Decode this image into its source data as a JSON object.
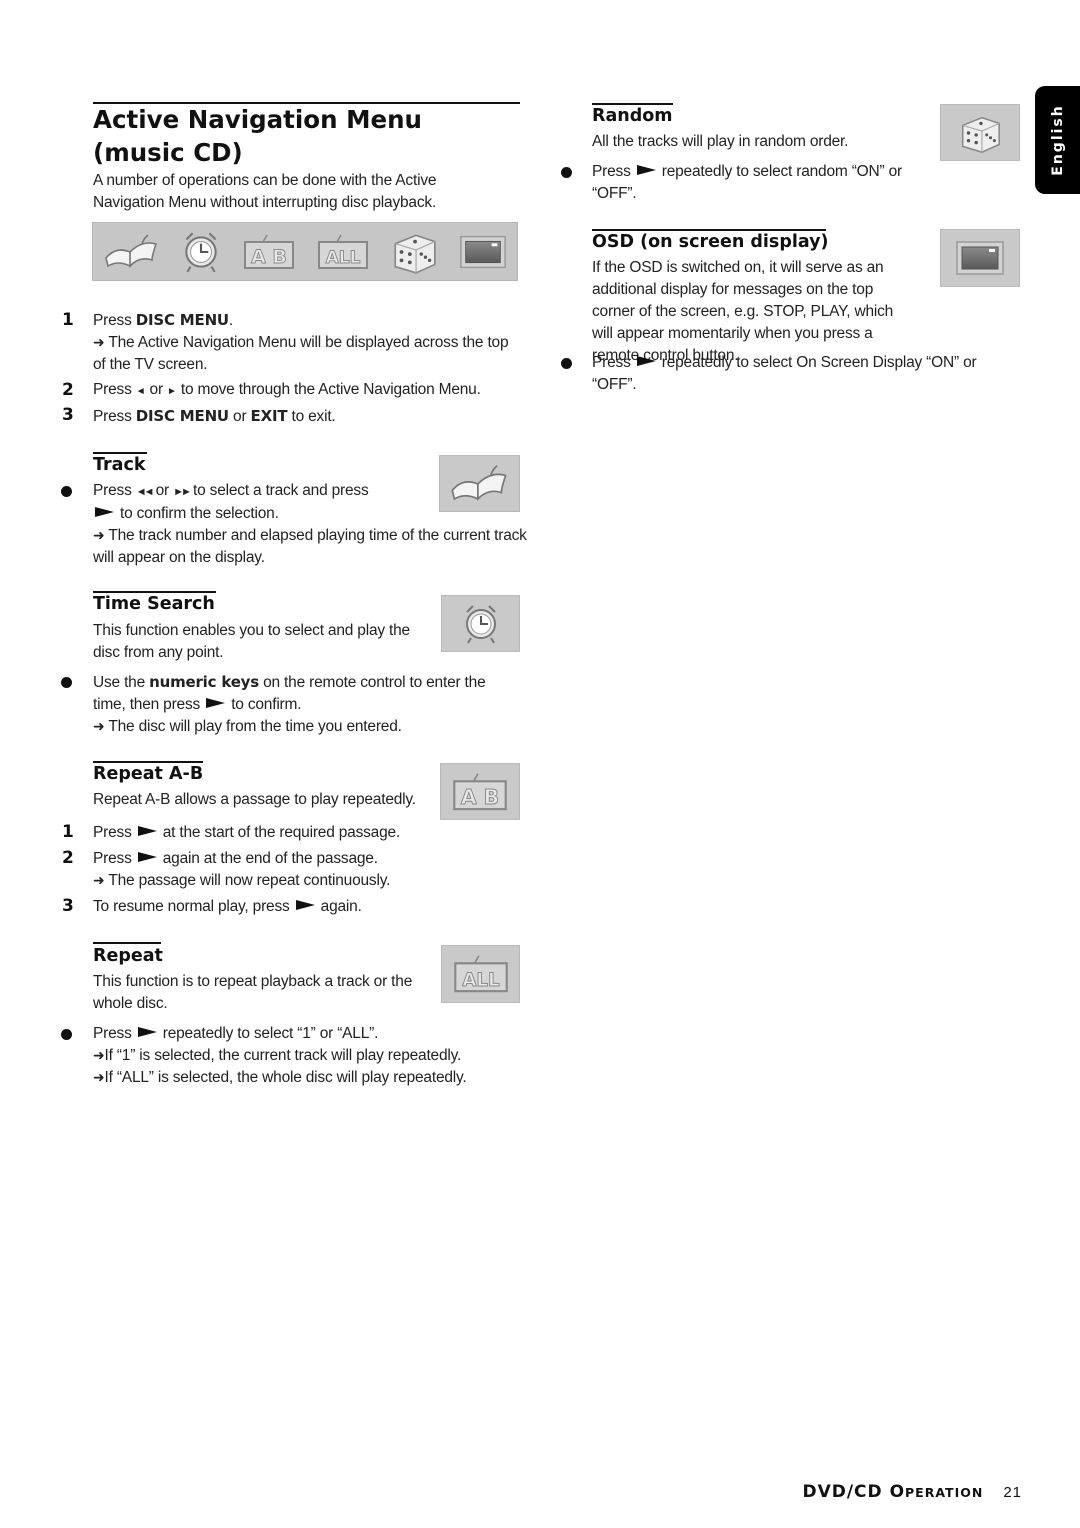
{
  "page": {
    "language_tab": "English",
    "footer": {
      "section_big": "DVD/CD O",
      "section_small": "PERATION",
      "section_full": "DVD/CD Operation",
      "page_number": "21"
    }
  },
  "intro": {
    "title_line1": "Active Navigation Menu",
    "title_line2": "(music CD)",
    "description": "A number of operations can be done with the Active Navigation Menu without interrupting disc playback.",
    "menu_icons": [
      "track-icon",
      "time-search-icon",
      "repeat-ab-icon",
      "repeat-all-icon",
      "random-icon",
      "osd-icon"
    ],
    "steps": [
      {
        "num": "1",
        "pre": "Press ",
        "bold": "DISC MENU",
        "post": ".",
        "result": "The Active Navigation Menu will be displayed across the top of the TV screen."
      },
      {
        "num": "2",
        "text_pre": "Press ",
        "key_left": "◄",
        "mid": " or ",
        "key_right": "►",
        "text_post": " to move through the Active Navigation Menu."
      },
      {
        "num": "3",
        "pre": "Press ",
        "bold1": "DISC MENU",
        "mid": " or ",
        "bold2": "EXIT",
        "post": " to exit."
      }
    ]
  },
  "track": {
    "title": "Track",
    "bullet_pre": "Press ",
    "key_prev": "◄◄",
    "mid": " or ",
    "key_next": "►►",
    "bullet_post": " to select a track and press",
    "confirm": "to confirm the selection.",
    "result": "The track number and elapsed playing time of the current track will appear on the display."
  },
  "time_search": {
    "title": "Time Search",
    "description": "This function enables you to select and play the disc from any point.",
    "bullet_pre": "Use the ",
    "bullet_bold": "numeric keys",
    "bullet_post": " on the remote control to enter the time, then press",
    "bullet_end": "to confirm.",
    "result": "The disc will play from the time you entered."
  },
  "repeat_ab": {
    "title": "Repeat A-B",
    "description": "Repeat A-B allows a passage to play repeatedly.",
    "steps": [
      {
        "num": "1",
        "pre": "Press",
        "post": "at the start of the required passage."
      },
      {
        "num": "2",
        "pre": "Press",
        "post": "again at the end of the passage.",
        "result": "The passage will now repeat continuously."
      },
      {
        "num": "3",
        "pre": "To resume normal play, press",
        "post": "again."
      }
    ]
  },
  "repeat": {
    "title": "Repeat",
    "description": "This function is to repeat playback a track or the whole disc.",
    "bullet_pre": "Press",
    "bullet_post": "repeatedly to select “1”  or “ALL”.",
    "results": [
      "If “1” is selected, the current track will play repeatedly.",
      "If “ALL” is selected, the whole disc will play repeatedly."
    ]
  },
  "random": {
    "title": "Random",
    "description": "All the tracks will play in random order.",
    "bullet_pre": "Press",
    "bullet_post": "repeatedly to select random “ON” or “OFF”."
  },
  "osd": {
    "title": "OSD (on screen display)",
    "description": "If the OSD is switched on, it will serve as an additional display for messages on the top corner of the screen, e.g. STOP, PLAY, which will appear momentarily when you press a remote control button.",
    "bullet_pre": "Press",
    "bullet_post": "repeatedly to select On Screen Display “ON” or “OFF”."
  },
  "arrow_symbol": "➜"
}
